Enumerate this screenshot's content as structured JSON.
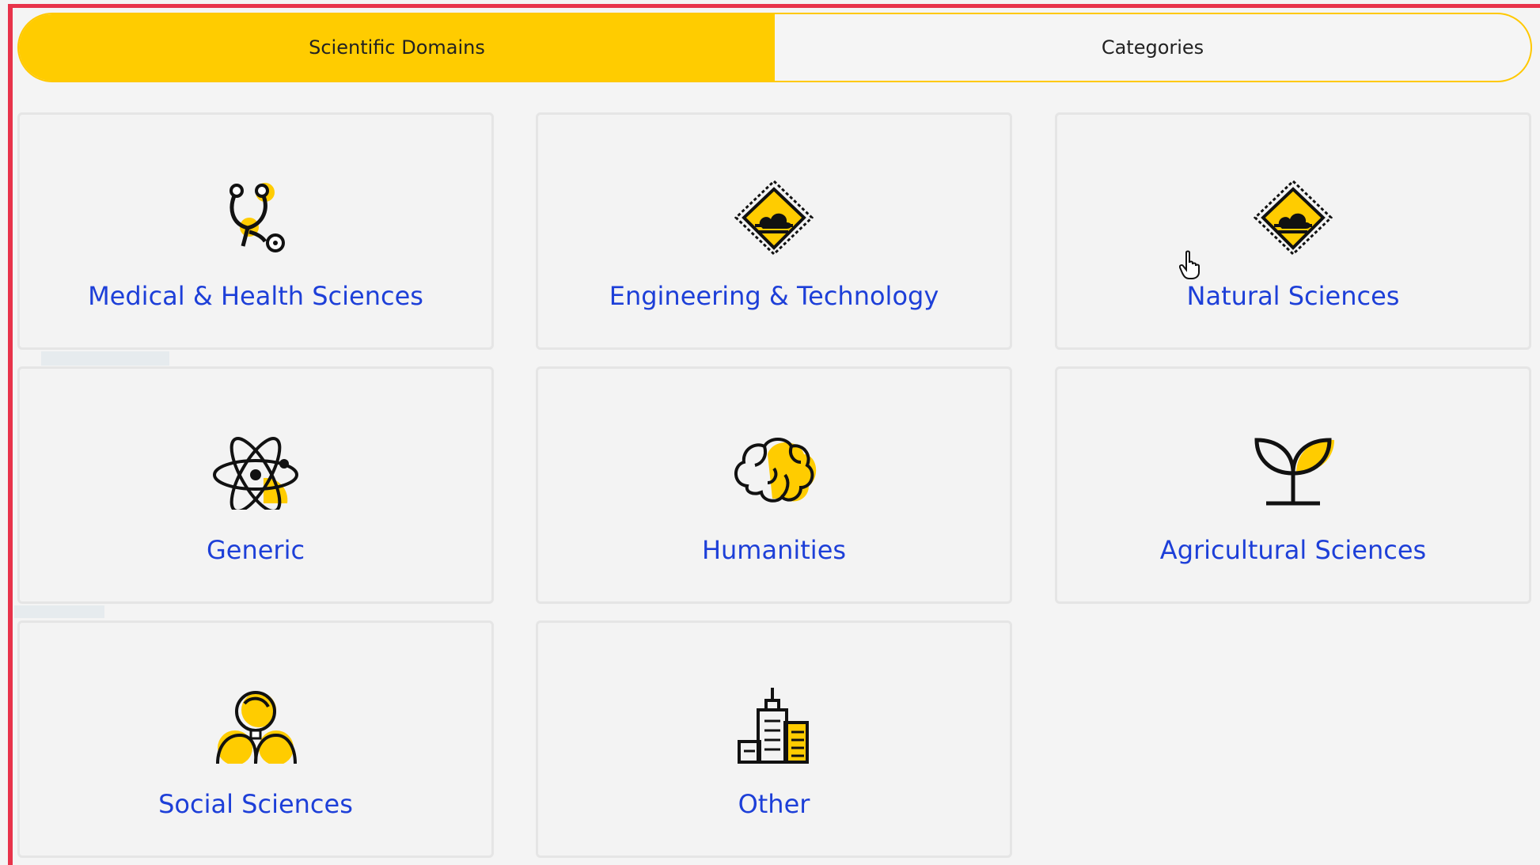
{
  "tabs": [
    {
      "label": "Scientific Domains",
      "active": true
    },
    {
      "label": "Categories",
      "active": false
    }
  ],
  "domains": [
    {
      "label": "Medical & Health Sciences",
      "icon": "stethoscope-icon"
    },
    {
      "label": "Engineering & Technology",
      "icon": "chip-cloud-icon"
    },
    {
      "label": "Natural Sciences",
      "icon": "chip-cloud-icon"
    },
    {
      "label": "Generic",
      "icon": "atom-icon"
    },
    {
      "label": "Humanities",
      "icon": "brain-icon"
    },
    {
      "label": "Agricultural Sciences",
      "icon": "sprout-icon"
    },
    {
      "label": "Social Sciences",
      "icon": "people-icon"
    },
    {
      "label": "Other",
      "icon": "buildings-icon"
    }
  ],
  "colors": {
    "accent": "#ffcc00",
    "link": "#1d3fd8",
    "border_highlight": "#e8334a"
  }
}
